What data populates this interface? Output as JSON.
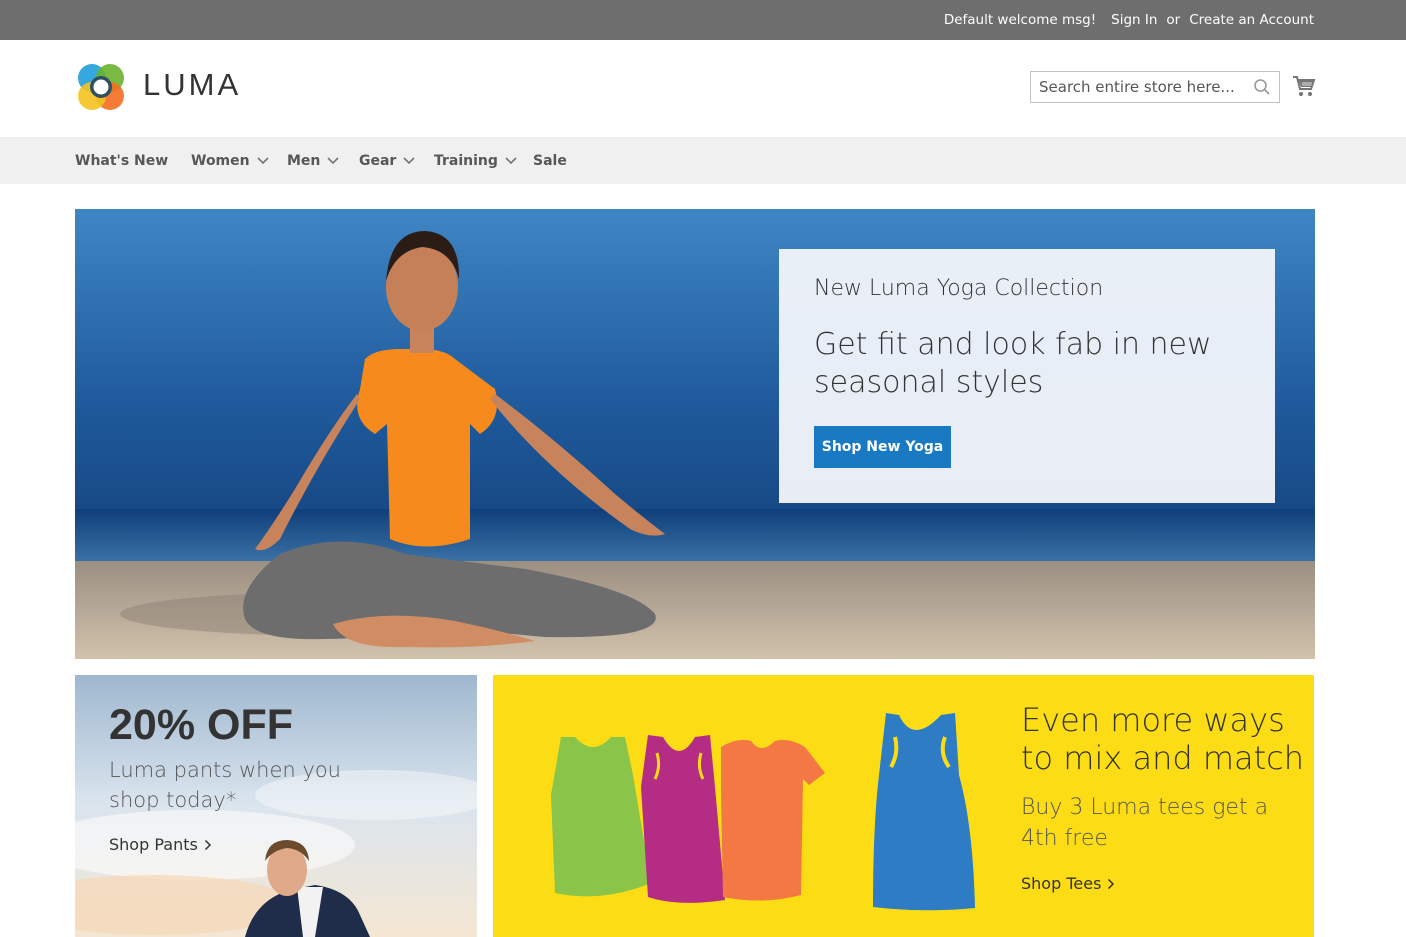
{
  "header_panel": {
    "welcome": "Default welcome msg!",
    "sign_in": "Sign In",
    "or": "or",
    "create_account": "Create an Account"
  },
  "logo": {
    "text": "LUMA"
  },
  "search": {
    "placeholder": "Search entire store here..."
  },
  "nav": {
    "items": [
      {
        "label": "What's New",
        "dropdown": false
      },
      {
        "label": "Women",
        "dropdown": true
      },
      {
        "label": "Men",
        "dropdown": true
      },
      {
        "label": "Gear",
        "dropdown": true
      },
      {
        "label": "Training",
        "dropdown": true
      },
      {
        "label": "Sale",
        "dropdown": false
      }
    ]
  },
  "hero": {
    "kicker": "New Luma Yoga Collection",
    "title": "Get fit and look fab in new seasonal styles",
    "button": "Shop New Yoga"
  },
  "promo_pants": {
    "title": "20% OFF",
    "subtitle": "Luma pants when you shop today*",
    "link": "Shop Pants"
  },
  "promo_tees": {
    "title": "Even more ways to mix and match",
    "subtitle": "Buy 3 Luma tees get a 4th free",
    "link": "Shop Tees"
  },
  "colors": {
    "top_bar": "#6e6e6e",
    "nav_bg": "#f0f0f0",
    "primary_button": "#1979c3",
    "promo_yellow": "#fcdc15"
  }
}
